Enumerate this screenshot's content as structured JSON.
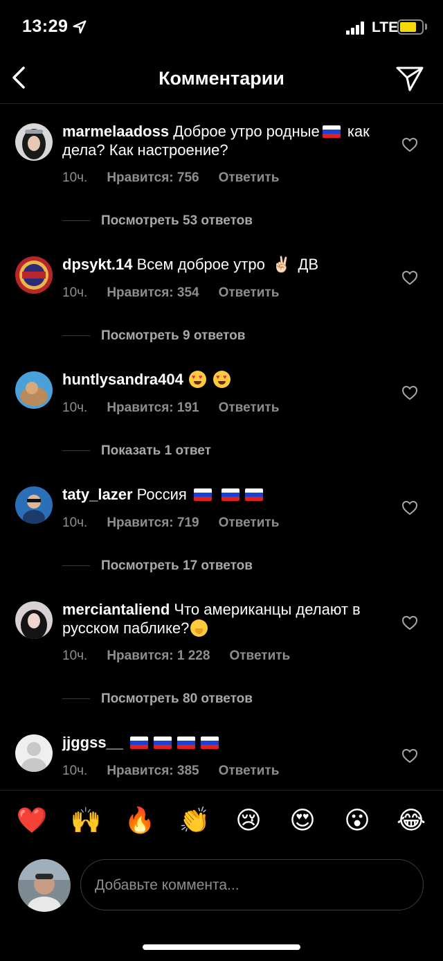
{
  "status_bar": {
    "time": "13:29",
    "network": "LTE",
    "battery_color": "#f5d90a"
  },
  "nav": {
    "title": "Комментарии",
    "back_icon": "chevron-left-icon",
    "share_icon": "send-icon"
  },
  "comments": [
    {
      "username": "marmelaadoss",
      "text_a": "Доброе утро родные",
      "text_b": "как дела? Как настроение?",
      "time": "10ч.",
      "likes": "Нравится: 756",
      "reply": "Ответить",
      "replies": "Посмотреть 53 ответов"
    },
    {
      "username": "dpsykt.14",
      "text_a": "Всем доброе утро",
      "text_b": "ДВ",
      "time": "10ч.",
      "likes": "Нравится: 354",
      "reply": "Ответить",
      "replies": "Посмотреть 9 ответов"
    },
    {
      "username": "huntlysandra404",
      "time": "10ч.",
      "likes": "Нравится: 191",
      "reply": "Ответить",
      "replies": "Показать 1 ответ"
    },
    {
      "username": "taty_lazer",
      "text_a": "Россия",
      "time": "10ч.",
      "likes": "Нравится: 719",
      "reply": "Ответить",
      "replies": "Посмотреть 17 ответов"
    },
    {
      "username": "merciantaliend",
      "text_a": "Что американцы",
      "text_b": "делают в русском паблике?",
      "time": "10ч.",
      "likes": "Нравится: 1 228",
      "reply": "Ответить",
      "replies": "Посмотреть 80 ответов"
    },
    {
      "username": "jjggss__",
      "time": "10ч.",
      "likes": "Нравится: 385",
      "reply": "Ответить"
    }
  ],
  "reactions": [
    "❤️",
    "🙌",
    "🔥",
    "👏",
    "😢",
    "😍",
    "😮",
    "😂"
  ],
  "composer": {
    "placeholder": "Добавьте коммента..."
  }
}
